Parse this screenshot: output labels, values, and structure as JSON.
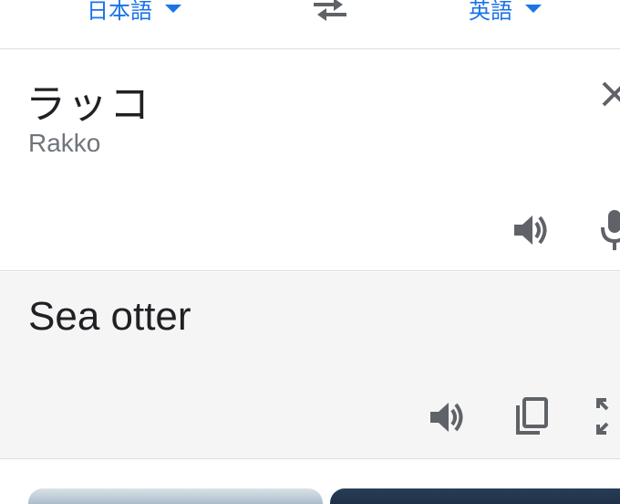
{
  "languages": {
    "source": "日本語",
    "target": "英語"
  },
  "icons": {
    "swap": "swap-arrows-icon",
    "clear": "close-icon",
    "source_speaker": "speaker-icon",
    "microphone": "microphone-icon",
    "target_speaker": "speaker-icon",
    "copy": "copy-icon",
    "fullscreen": "fullscreen-icon"
  },
  "source": {
    "text": "ラッコ",
    "romanization": "Rakko"
  },
  "target": {
    "text": "Sea otter"
  },
  "colors": {
    "accent": "#1a73e8",
    "icon": "#5f6368",
    "source_text": "#202124",
    "romanization": "#70757a",
    "target_background": "#f5f5f5",
    "divider": "#dadce0"
  }
}
